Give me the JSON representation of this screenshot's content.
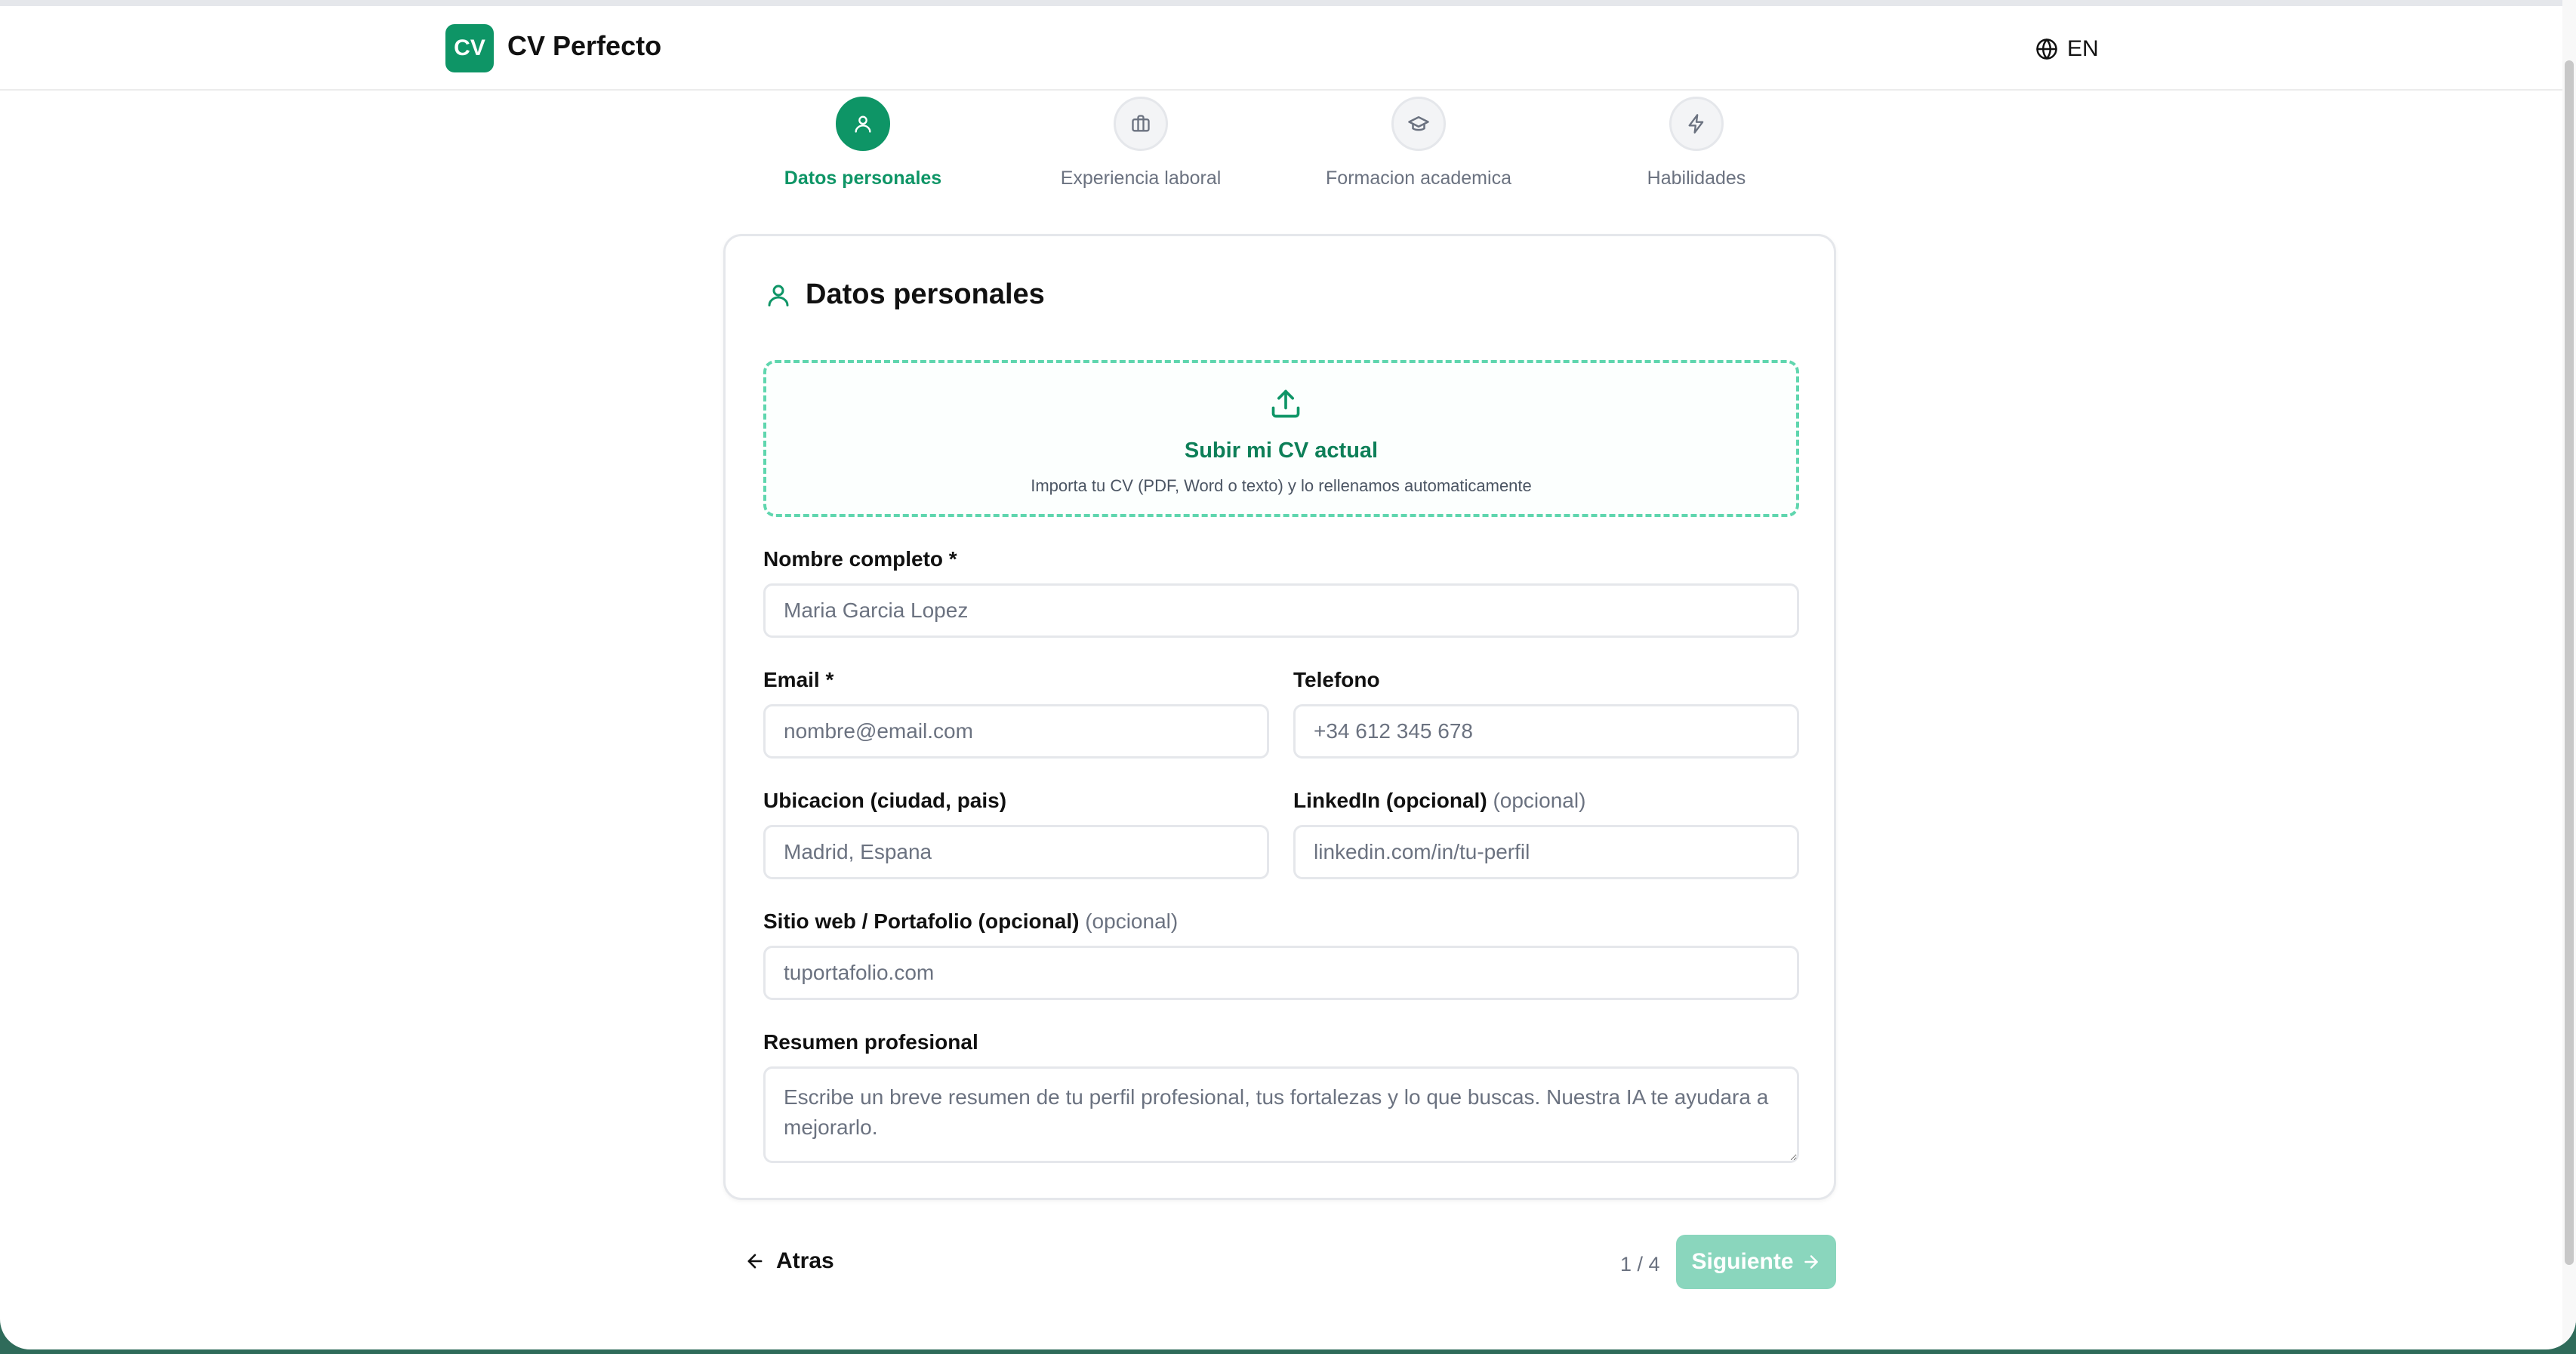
{
  "header": {
    "logo_text": "CV",
    "brand": "CV Perfecto",
    "language": "EN"
  },
  "steps": [
    {
      "label": "Datos personales",
      "icon": "user-icon",
      "active": true
    },
    {
      "label": "Experiencia laboral",
      "icon": "briefcase-icon",
      "active": false
    },
    {
      "label": "Formacion academica",
      "icon": "graduation-cap-icon",
      "active": false
    },
    {
      "label": "Habilidades",
      "icon": "lightning-icon",
      "active": false
    }
  ],
  "card": {
    "title": "Datos personales",
    "upload": {
      "title": "Subir mi CV actual",
      "subtitle": "Importa tu CV (PDF, Word o texto) y lo rellenamos automaticamente"
    },
    "fields": {
      "name": {
        "label": "Nombre completo *",
        "placeholder": "Maria Garcia Lopez"
      },
      "email": {
        "label": "Email *",
        "placeholder": "nombre@email.com"
      },
      "phone": {
        "label": "Telefono",
        "placeholder": "+34 612 345 678"
      },
      "location": {
        "label": "Ubicacion (ciudad, pais)",
        "placeholder": "Madrid, Espana"
      },
      "linkedin": {
        "label": "LinkedIn (opcional)",
        "optional": "(opcional)",
        "placeholder": "linkedin.com/in/tu-perfil"
      },
      "website": {
        "label": "Sitio web / Portafolio (opcional)",
        "optional": "(opcional)",
        "placeholder": "tuportafolio.com"
      },
      "summary": {
        "label": "Resumen profesional",
        "placeholder": "Escribe un breve resumen de tu perfil profesional, tus fortalezas y lo que buscas. Nuestra IA te ayudara a mejorarlo."
      }
    }
  },
  "footer": {
    "back_label": "Atras",
    "counter": "1 / 4",
    "next_label": "Siguiente"
  },
  "colors": {
    "accent": "#0e9566",
    "accent_disabled": "#8ad6bd",
    "upload_border": "#5fd6ae"
  }
}
